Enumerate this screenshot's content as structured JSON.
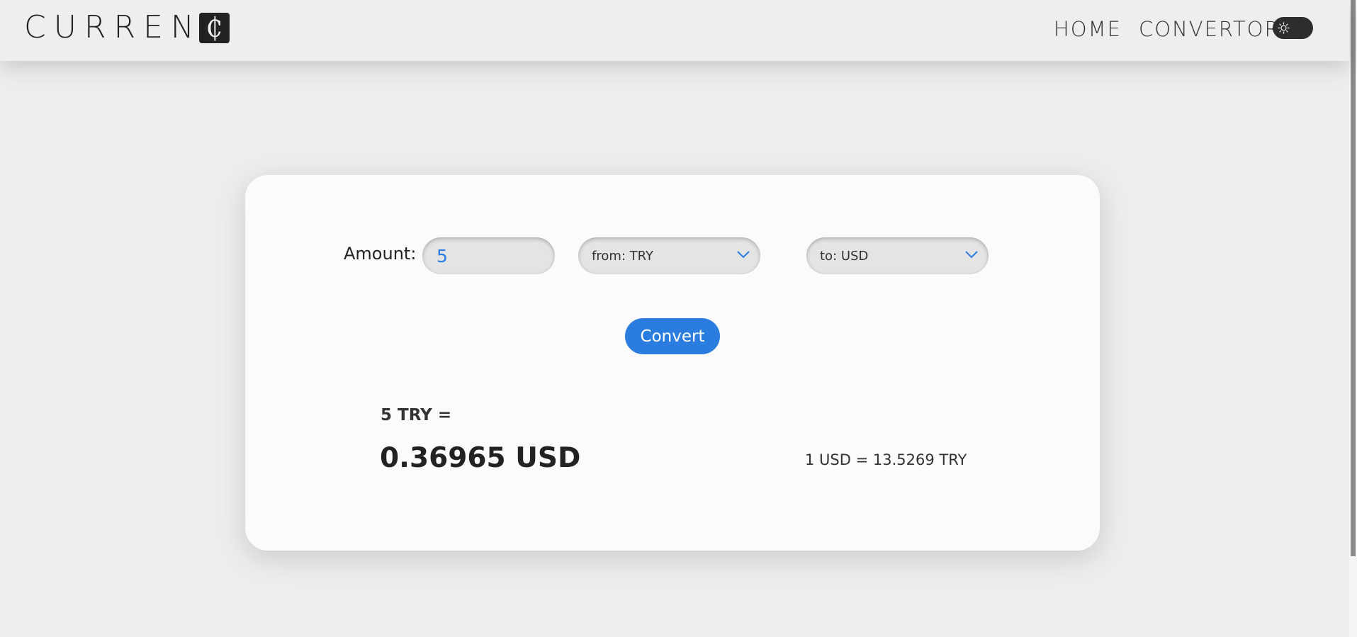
{
  "header": {
    "logo_text": "CURREN",
    "logo_mark": "₵",
    "nav": {
      "home": "HOME",
      "convertor": "CONVERTOR"
    },
    "theme_toggle_icon": "sun-icon"
  },
  "converter": {
    "amount_label": "Amount:",
    "amount_value": "5",
    "from_select": "from: TRY",
    "to_select": "to: USD",
    "convert_label": "Convert",
    "result_from": "5 TRY =",
    "result_value": "0.36965 USD",
    "rate": "1 USD = 13.5269 TRY"
  },
  "colors": {
    "accent": "#2a7ddf",
    "background": "#ededed",
    "card": "#fbfbfb"
  }
}
